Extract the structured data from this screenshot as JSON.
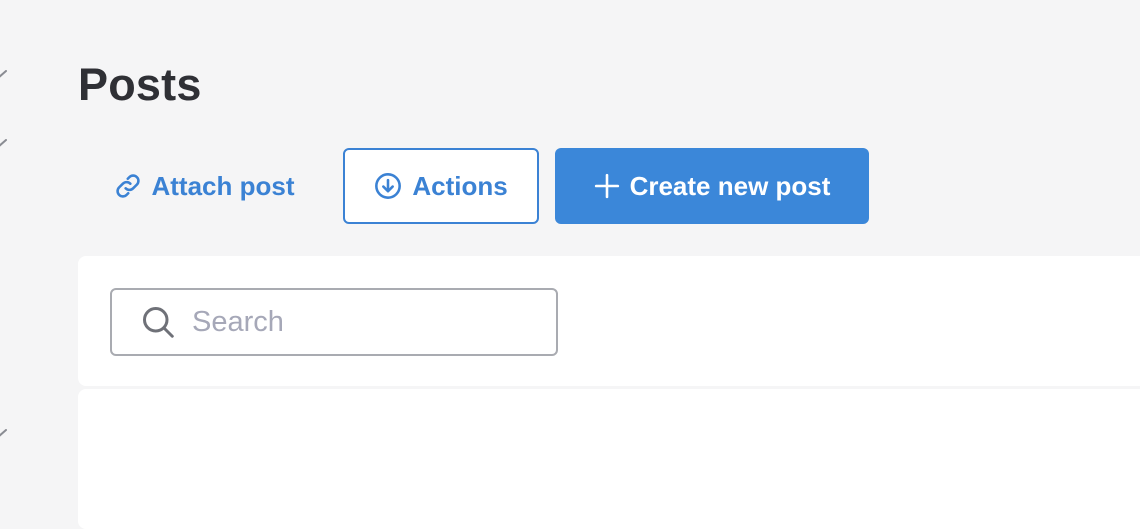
{
  "page": {
    "title": "Posts"
  },
  "toolbar": {
    "attach_label": "Attach post",
    "actions_label": "Actions",
    "create_label": "Create new post"
  },
  "search": {
    "placeholder": "Search",
    "value": ""
  },
  "icons": {
    "attach": "link-icon",
    "actions": "download-circle-icon",
    "create": "plus-icon",
    "search": "search-icon"
  },
  "colors": {
    "accent": "#3b82d4",
    "primary_button": "#3b87d9",
    "background": "#f5f5f6",
    "panel": "#ffffff"
  }
}
